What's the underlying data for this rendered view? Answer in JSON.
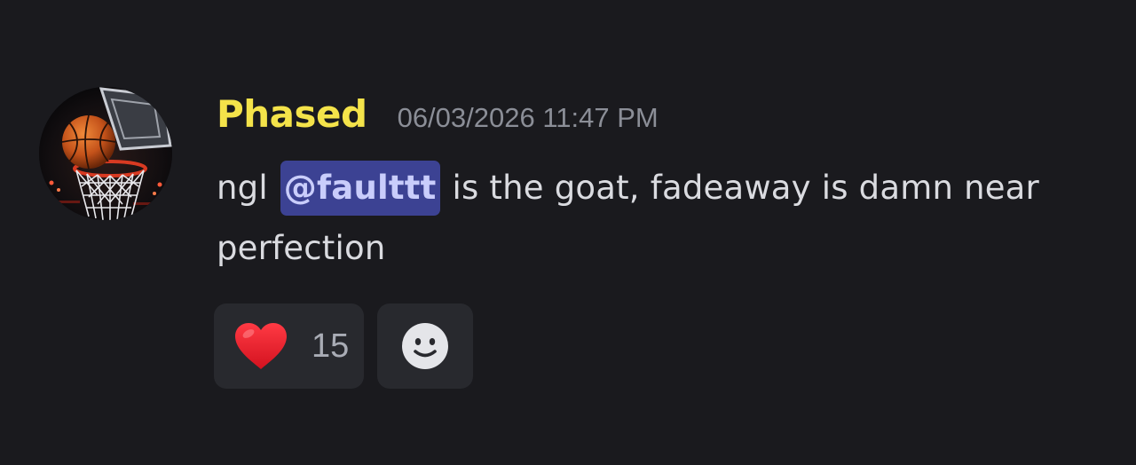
{
  "message": {
    "author": "Phased",
    "timestamp": "06/03/2026 11:47 PM",
    "text_before_mention": "ngl ",
    "mention": "@faulttt",
    "text_after_mention": " is the goat, fadeaway is damn near perfection"
  },
  "avatar": {
    "icon": "basketball-hoop-avatar"
  },
  "reactions": [
    {
      "icon": "red-heart-icon",
      "count": "15"
    }
  ],
  "add_reaction": {
    "icon": "smiley-face-icon"
  },
  "colors": {
    "background": "#1a1a1e",
    "username": "#f4e34a",
    "timestamp": "#8b8e97",
    "message_text": "#dadbe0",
    "mention_bg": "#3c4293",
    "mention_text": "#c9cdfb",
    "reaction_bg": "#28292e",
    "heart": "#e8202f"
  }
}
